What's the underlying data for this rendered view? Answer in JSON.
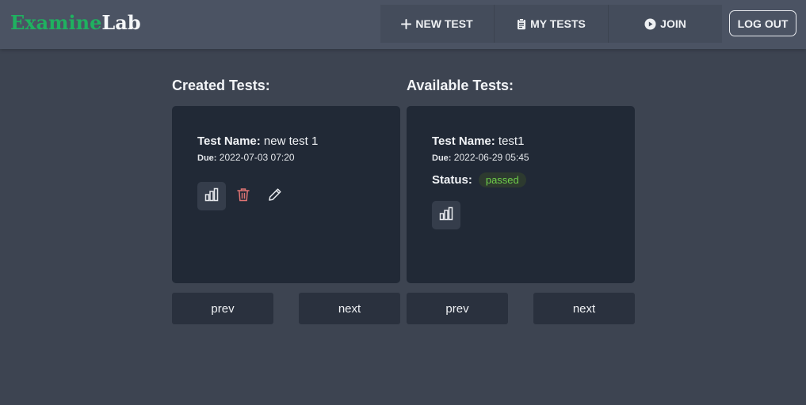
{
  "brand": {
    "part1": "Examine",
    "part2": "Lab",
    "color1": "#1fb160",
    "color2": "#f4f6f8"
  },
  "nav": {
    "new_test": {
      "label": "NEW TEST",
      "icon": "plus-icon"
    },
    "my_tests": {
      "label": "MY TESTS",
      "icon": "clipboard-icon"
    },
    "join": {
      "label": "JOIN",
      "icon": "play-circle-icon"
    },
    "logout": "LOG OUT"
  },
  "created": {
    "title": "Created Tests:",
    "card": {
      "name_label": "Test Name:",
      "name": "new test 1",
      "due_label": "Due:",
      "due": "2022-07-03 07:20",
      "actions": [
        "chart-bar-icon",
        "trash-icon",
        "pencil-icon"
      ]
    },
    "prev": "prev",
    "next": "next"
  },
  "available": {
    "title": "Available Tests:",
    "card": {
      "name_label": "Test Name:",
      "name": "test1",
      "due_label": "Due:",
      "due": "2022-06-29 05:45",
      "status_label": "Status:",
      "status": "passed",
      "actions": [
        "chart-bar-icon"
      ]
    },
    "prev": "prev",
    "next": "next"
  },
  "colors": {
    "background": "#3d4451",
    "navbar": "#4b5363",
    "card": "#212936",
    "delete": "#e07474",
    "passed_text": "#6fcf4a"
  }
}
